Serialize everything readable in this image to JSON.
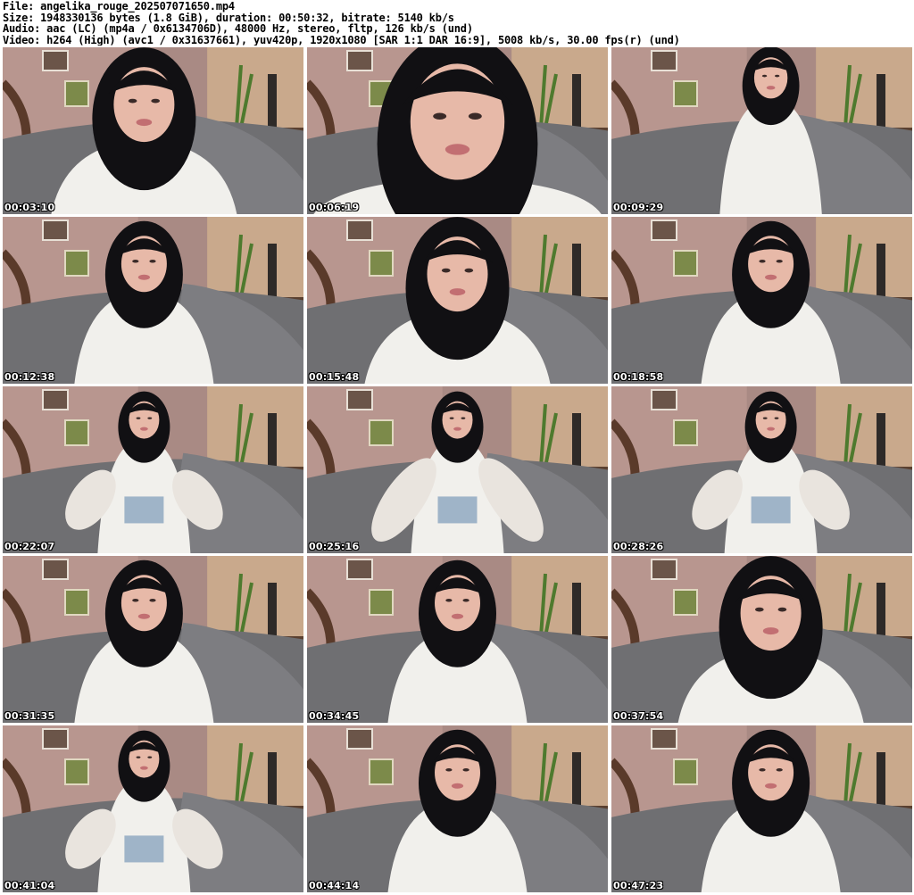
{
  "header": {
    "file_line": "File: angelika_rouge_202507071650.mp4",
    "size_line": "Size: 1948330136 bytes (1.8 GiB), duration: 00:50:32, bitrate: 5140 kb/s",
    "audio_line": "Audio: aac (LC) (mp4a / 0x6134706D), 48000 Hz, stereo, fltp, 126 kb/s (und)",
    "video_line": "Video: h264 (High) (avc1 / 0x31637661), yuv420p, 1920x1080 [SAR 1:1 DAR 16:9], 5008 kb/s, 30.00 fps(r) (und)"
  },
  "thumbnails": [
    {
      "timestamp": "00:03:10",
      "shot": "close"
    },
    {
      "timestamp": "00:06:19",
      "shot": "closeup"
    },
    {
      "timestamp": "00:09:29",
      "shot": "wide"
    },
    {
      "timestamp": "00:12:38",
      "shot": "medium"
    },
    {
      "timestamp": "00:15:48",
      "shot": "close"
    },
    {
      "timestamp": "00:18:58",
      "shot": "medium"
    },
    {
      "timestamp": "00:22:07",
      "shot": "legs"
    },
    {
      "timestamp": "00:25:16",
      "shot": "legs-close"
    },
    {
      "timestamp": "00:28:26",
      "shot": "legs"
    },
    {
      "timestamp": "00:31:35",
      "shot": "medium"
    },
    {
      "timestamp": "00:34:45",
      "shot": "medium"
    },
    {
      "timestamp": "00:37:54",
      "shot": "close"
    },
    {
      "timestamp": "00:41:04",
      "shot": "legs"
    },
    {
      "timestamp": "00:44:14",
      "shot": "medium"
    },
    {
      "timestamp": "00:47:23",
      "shot": "medium"
    }
  ]
}
